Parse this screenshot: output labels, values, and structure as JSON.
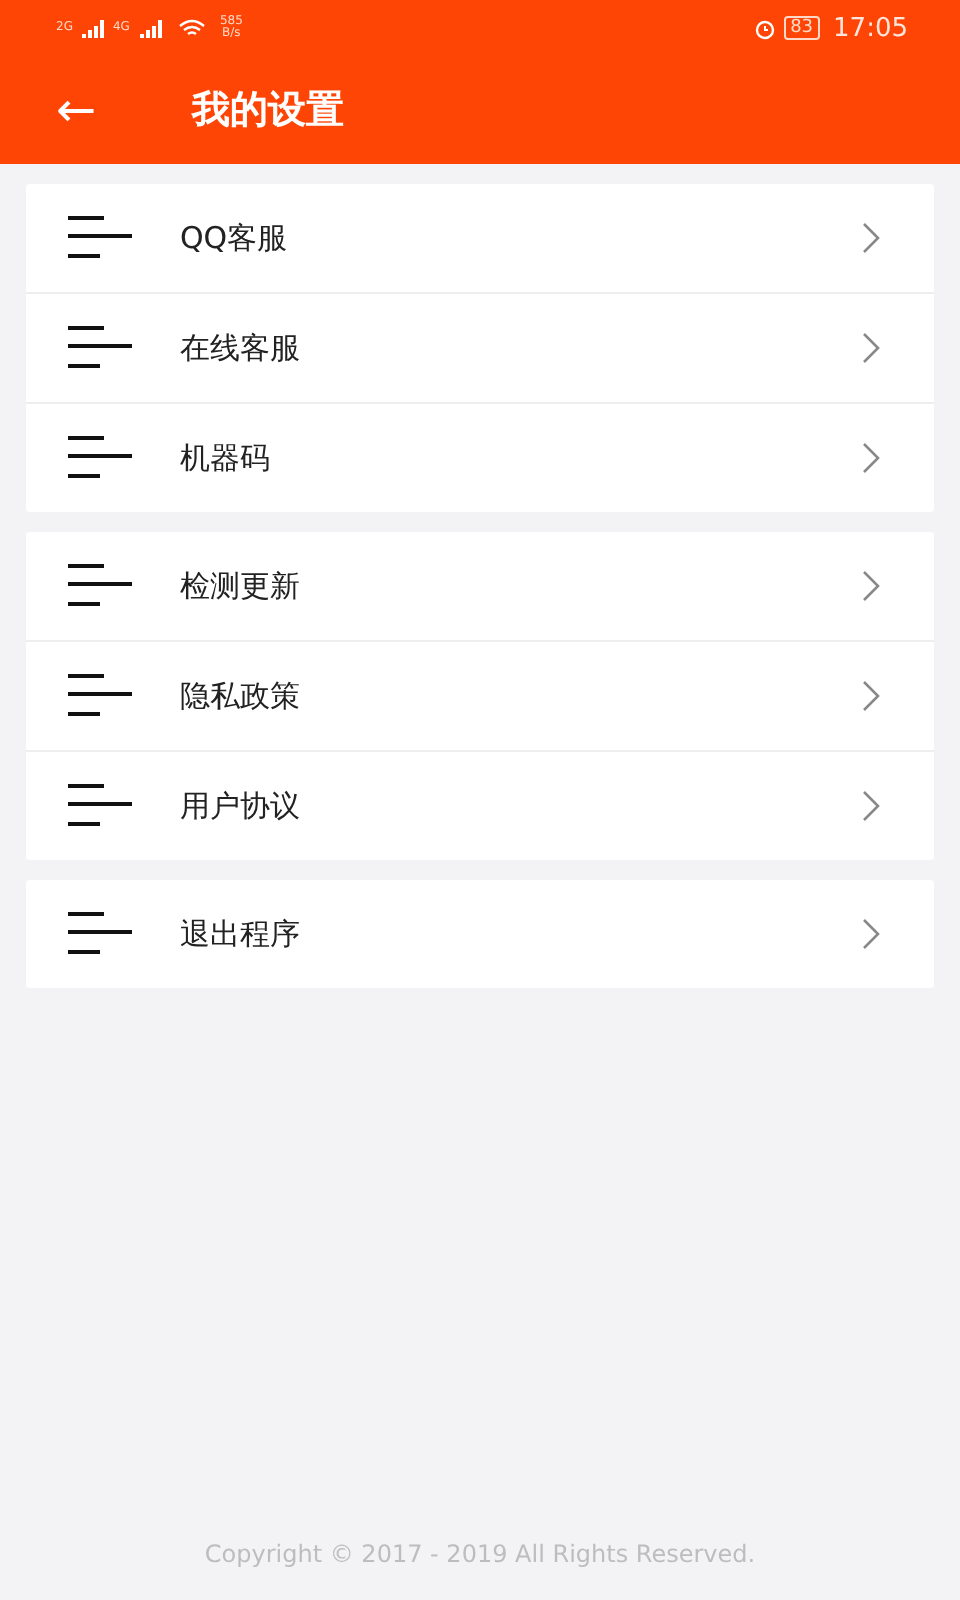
{
  "status_bar": {
    "sim_1": "2G",
    "sim_2": "4G",
    "speed": "585",
    "speed_unit": "B/s",
    "battery": "83",
    "time": "17:05"
  },
  "header": {
    "back": "←",
    "title": "我的设置"
  },
  "groups": [
    {
      "items": [
        {
          "label": "QQ客服"
        },
        {
          "label": "在线客服"
        },
        {
          "label": "机器码"
        }
      ]
    },
    {
      "items": [
        {
          "label": "检测更新"
        },
        {
          "label": "隐私政策"
        },
        {
          "label": "用户协议"
        }
      ]
    },
    {
      "items": [
        {
          "label": "退出程序"
        }
      ]
    }
  ],
  "footer": "Copyright © 2017 - 2019 All Rights Reserved."
}
